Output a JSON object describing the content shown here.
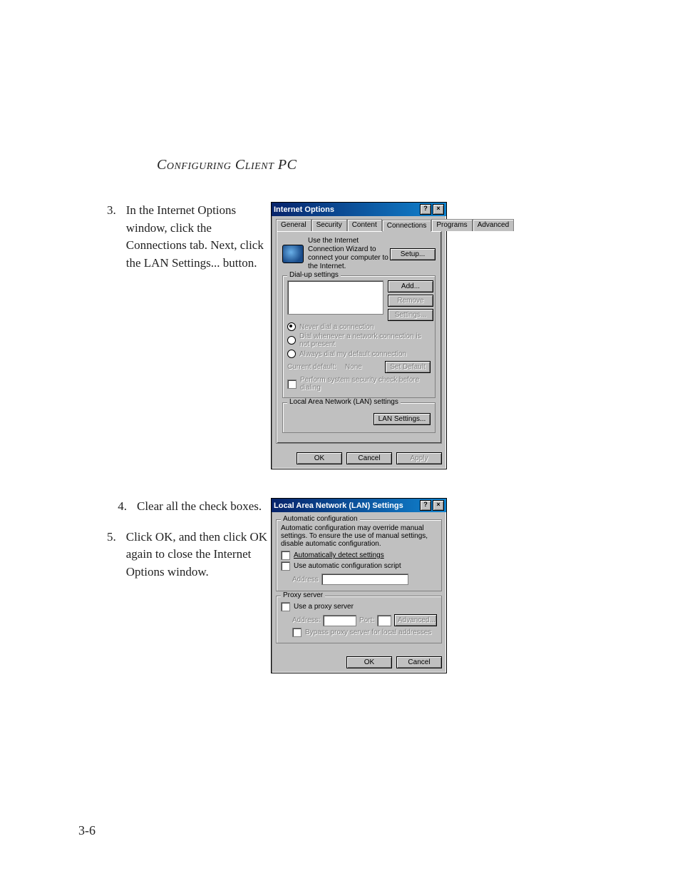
{
  "header": "Configuring Client PC",
  "page_number": "3-6",
  "step3": {
    "num": "3.",
    "text": "In the Internet Options window, click the Connections tab. Next, click the LAN Settings... button."
  },
  "step4": {
    "num": "4.",
    "text": "Clear all the check boxes."
  },
  "step5": {
    "num": "5.",
    "text": "Click OK, and then click OK again to close the Internet Options window."
  },
  "dlg1": {
    "title": "Internet Options",
    "help_btn": "?",
    "close_btn": "×",
    "tabs": [
      "General",
      "Security",
      "Content",
      "Connections",
      "Programs",
      "Advanced"
    ],
    "active_tab": "Connections",
    "wizard_text": "Use the Internet Connection Wizard to connect your computer to the Internet.",
    "setup_btn": "Setup...",
    "dialup_legend": "Dial-up settings",
    "add_btn": "Add...",
    "remove_btn": "Remove",
    "settings_btn": "Settings...",
    "radio1": "Never dial a connection",
    "radio2": "Dial whenever a network connection is not present",
    "radio3": "Always dial my default connection",
    "current_label": "Current default:",
    "current_value": "None",
    "setdefault_btn": "Set Default",
    "syscheck": "Perform system security check before dialing",
    "lan_legend": "Local Area Network (LAN) settings",
    "lan_btn": "LAN Settings...",
    "ok": "OK",
    "cancel": "Cancel",
    "apply": "Apply"
  },
  "dlg2": {
    "title": "Local Area Network (LAN) Settings",
    "help_btn": "?",
    "close_btn": "×",
    "auto_legend": "Automatic configuration",
    "auto_text": "Automatic configuration may override manual settings. To ensure the use of manual settings, disable automatic configuration.",
    "chk_auto": "Automatically detect settings",
    "chk_script": "Use automatic configuration script",
    "addr_label": "Address",
    "proxy_legend": "Proxy server",
    "chk_proxy": "Use a proxy server",
    "paddr_label": "Address:",
    "port_label": "Port:",
    "adv_btn": "Advanced...",
    "bypass": "Bypass proxy server for local addresses",
    "ok": "OK",
    "cancel": "Cancel"
  }
}
